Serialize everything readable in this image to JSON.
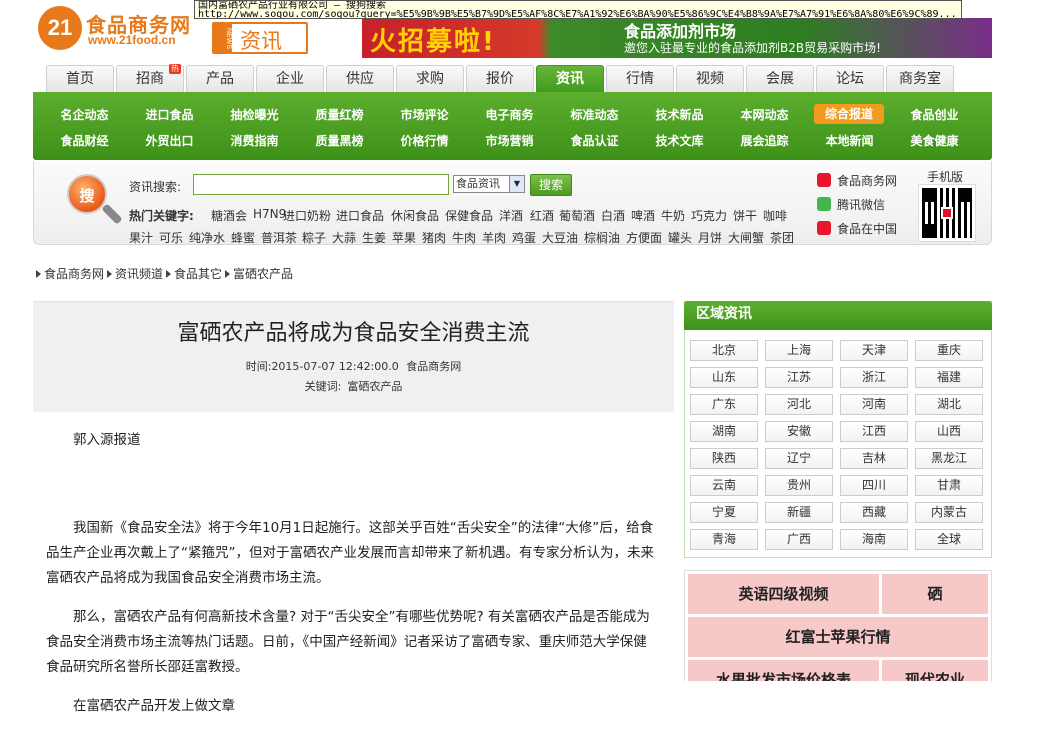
{
  "tooltip": {
    "line1": "国内富硒农产品行业有限公司 — 搜狗搜索",
    "line2": "http://www.sogou.com/sogou?query=%E5%9B%9B%E5%B7%9D%E5%AF%8C%E7%A1%92%E6%BA%90%E5%86%9C%E4%B8%9A%E7%A7%91%E6%8A%80%E6%9C%89..."
  },
  "header": {
    "logo_num": "21",
    "logo_name": "食品商务网",
    "logo_url": "www.21food.cn",
    "channel_side": "NEWS",
    "channel": "资讯",
    "banner_big": "火招募啦!",
    "banner_title": "食品添加剂市场",
    "banner_sub": "邀您入驻最专业的食品添加剂B2B贸易采购市场!"
  },
  "navtabs": [
    "首页",
    "招商",
    "产品",
    "企业",
    "供应",
    "求购",
    "报价",
    "资讯",
    "行情",
    "视频",
    "会展",
    "论坛",
    "商务室"
  ],
  "hot_badge": "热",
  "subnav": {
    "row1": [
      "名企动态",
      "进口食品",
      "抽检曝光",
      "质量红榜",
      "市场评论",
      "电子商务",
      "标准动态",
      "技术新品",
      "本网动态",
      "综合报道",
      "食品创业"
    ],
    "row2": [
      "食品财经",
      "外贸出口",
      "消费指南",
      "质量黑榜",
      "价格行情",
      "市场营销",
      "食品认证",
      "技术文库",
      "展会追踪",
      "本地新闻",
      "美食健康"
    ]
  },
  "search": {
    "icon_text": "搜",
    "label": "资讯搜索:",
    "value": "",
    "select": "食品资讯",
    "button": "搜索",
    "hot_label": "热门关键字:",
    "row1": [
      "糖酒会",
      "H7N9",
      "进口奶粉",
      "进口食品",
      "休闲食品",
      "保健食品",
      "洋酒",
      "红酒",
      "葡萄酒",
      "白酒",
      "啤酒",
      "牛奶",
      "巧克力",
      "饼干",
      "咖啡"
    ],
    "row2": [
      "果汁",
      "可乐",
      "纯净水",
      "蜂蜜",
      "普洱茶",
      "粽子",
      "大蒜",
      "生姜",
      "苹果",
      "猪肉",
      "牛肉",
      "羊肉",
      "鸡蛋",
      "大豆油",
      "棕榈油",
      "方便面",
      "罐头",
      "月饼",
      "大闸蟹",
      "茶团"
    ]
  },
  "social": {
    "weibo": "食品商务网",
    "wechat": "腾讯微信",
    "weibo2": "食品在中国",
    "mobile": "手机版"
  },
  "breadcrumb": [
    "食品商务网",
    "资讯频道",
    "食品其它",
    "富硒农产品"
  ],
  "article": {
    "title": "富硒农产品将成为食品安全消费主流",
    "time_label": "时间:",
    "time": "2015-07-07 12:42:00.0",
    "source": "食品商务网",
    "kw_label": "关键词:",
    "keyword": "富硒农产品",
    "paragraphs": [
      "郭入源报道",
      "",
      "我国新《食品安全法》将于今年10月1日起施行。这部关乎百姓“舌尖安全”的法律“大修”后，给食品生产企业再次戴上了“紧箍咒”，但对于富硒农产业发展而言却带来了新机遇。有专家分析认为，未来富硒农产品将成为我国食品安全消费市场主流。",
      "那么，富硒农产品有何高新技术含量? 对于“舌尖安全”有哪些优势呢? 有关富硒农产品是否能成为食品安全消费市场主流等热门话题。日前，《中国产经新闻》记者采访了富硒专家、重庆师范大学保健食品研究所名誉所长邵廷富教授。",
      "在富硒农产品开发上做文章"
    ]
  },
  "region": {
    "title": "区域资讯",
    "cities": [
      "北京",
      "上海",
      "天津",
      "重庆",
      "山东",
      "江苏",
      "浙江",
      "福建",
      "广东",
      "河北",
      "河南",
      "湖北",
      "湖南",
      "安徽",
      "江西",
      "山西",
      "陕西",
      "辽宁",
      "吉林",
      "黑龙江",
      "云南",
      "贵州",
      "四川",
      "甘肃",
      "宁夏",
      "新疆",
      "西藏",
      "内蒙古",
      "青海",
      "广西",
      "海南",
      "全球"
    ]
  },
  "pinkbox": {
    "a": "英语四级视频",
    "b": "硒",
    "c": "红富士苹果行情",
    "d": "水果批发市场价格表",
    "e": "现代农业"
  }
}
